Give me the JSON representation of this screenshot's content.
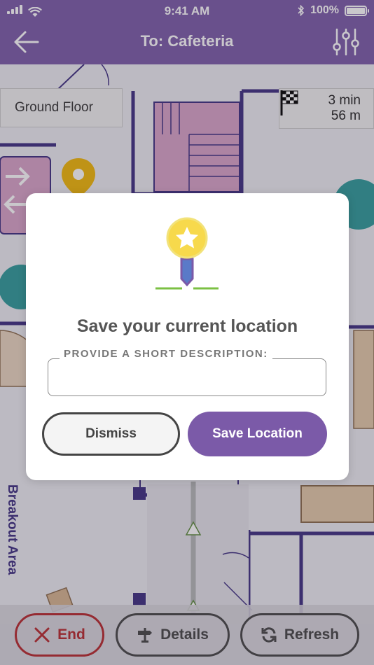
{
  "status_bar": {
    "time": "9:41 AM",
    "battery": "100%"
  },
  "header": {
    "title": "To: Cafeteria"
  },
  "map": {
    "floor": "Ground Floor",
    "eta_time": "3 min",
    "eta_distance": "56 m",
    "area_label": "Breakout Area"
  },
  "modal": {
    "title": "Save your current location",
    "field_label": "PROVIDE A SHORT DESCRIPTION:",
    "field_value": "",
    "dismiss_label": "Dismiss",
    "save_label": "Save Location"
  },
  "bottom_bar": {
    "end_label": "End",
    "details_label": "Details",
    "refresh_label": "Refresh"
  },
  "colors": {
    "brand": "#7b5aa8",
    "end_red": "#b7282c",
    "wall": "#3c2d80",
    "stairs": "#d9a3c8",
    "pin": "#f2b705",
    "restroom": "#2d9a9a"
  }
}
